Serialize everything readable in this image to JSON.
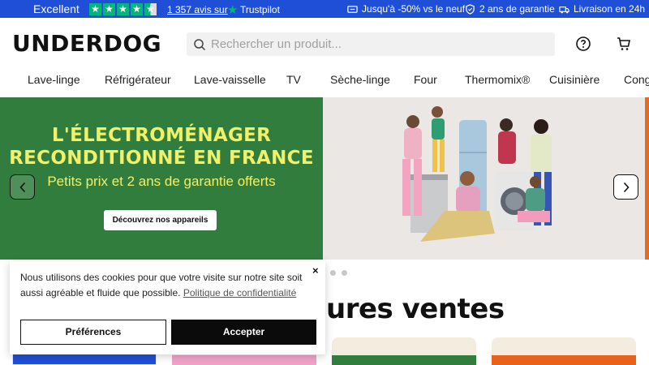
{
  "topbar": {
    "rating_text": "Excellent",
    "reviews_count": "1 357 avis sur",
    "trustpilot_label": "Trustpilot",
    "perk_discount": "Jusqu'à -50% vs le neuf",
    "perk_warranty": "2 ans de garantie",
    "perk_delivery": "Livraison en 24h",
    "brand_color": "#1f4fd6",
    "star_color": "#00b67a",
    "star_rating": 4.5
  },
  "header": {
    "logo": "UNDERDOG",
    "search_placeholder": "Rechercher un produit...",
    "help_icon": "question-circle-icon",
    "cart_icon": "cart-icon"
  },
  "nav": {
    "items": [
      "Lave-linge",
      "Réfrigérateur",
      "Lave-vaisselle",
      "TV",
      "Sèche-linge",
      "Four",
      "Thermomix®",
      "Cuisinière",
      "Conge"
    ]
  },
  "hero": {
    "title_line1": "L'ÉLECTROMÉNAGER",
    "title_line2": "RECONDITIONNÉ EN FRANCE",
    "subtitle": "Petits prix et 2 ans de garantie offerts",
    "cta": "Découvrez nos appareils",
    "bg_color": "#317d3e",
    "text_color": "#f0f06a"
  },
  "section": {
    "title": "ures ventes"
  },
  "cookie": {
    "text": "Nous utilisons des cookies pour que votre visite sur notre site soit aussi agréable et fluide que possible.",
    "link": "Politique de confidentialité",
    "close": "×",
    "preferences": "Préférences",
    "accept": "Accepter"
  }
}
